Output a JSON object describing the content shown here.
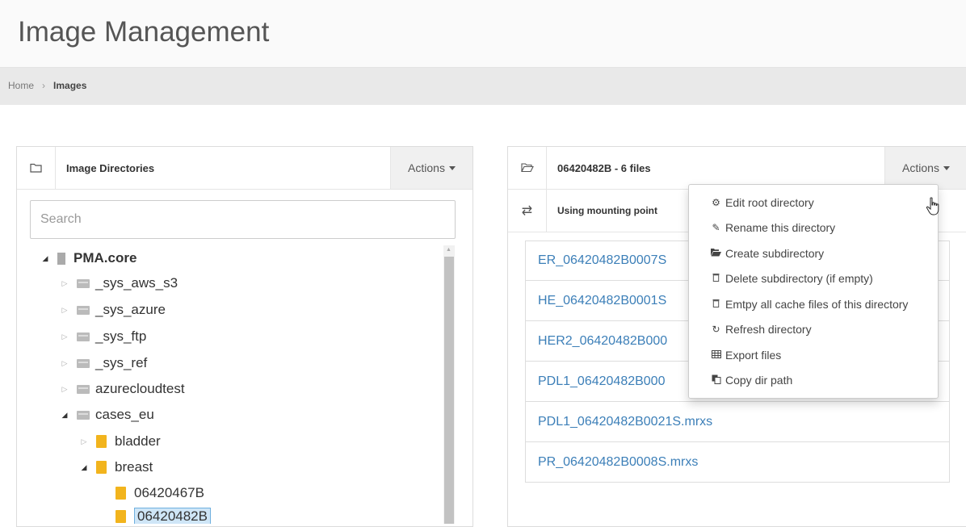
{
  "page": {
    "title": "Image Management"
  },
  "breadcrumb": {
    "home": "Home",
    "current": "Images"
  },
  "left_panel": {
    "title": "Image Directories",
    "actions_label": "Actions",
    "search_placeholder": "Search",
    "tree": {
      "root": "PMA.core",
      "items": [
        {
          "label": "_sys_aws_s3"
        },
        {
          "label": "_sys_azure"
        },
        {
          "label": "_sys_ftp"
        },
        {
          "label": "_sys_ref"
        },
        {
          "label": "azurecloudtest"
        },
        {
          "label": "cases_eu"
        },
        {
          "label": "bladder"
        },
        {
          "label": "breast"
        },
        {
          "label": "06420467B"
        },
        {
          "label": "06420482B"
        }
      ]
    }
  },
  "right_panel": {
    "title": "06420482B - 6 files",
    "actions_label": "Actions",
    "mount_text": "Using mounting point",
    "files": [
      "ER_06420482B0007S",
      "HE_06420482B0001S",
      "HER2_06420482B000",
      "PDL1_06420482B000",
      "PDL1_06420482B0021S.mrxs",
      "PR_06420482B0008S.mrxs"
    ]
  },
  "actions_menu": {
    "items": [
      {
        "label": "Edit root directory",
        "icon": "cogs-icon"
      },
      {
        "label": "Rename this directory",
        "icon": "pencil-icon"
      },
      {
        "label": "Create subdirectory",
        "icon": "folder-open-icon"
      },
      {
        "label": "Delete subdirectory (if empty)",
        "icon": "trash-icon"
      },
      {
        "label": "Emtpy all cache files of this directory",
        "icon": "trash-icon"
      },
      {
        "label": "Refresh directory",
        "icon": "refresh-icon"
      },
      {
        "label": "Export files",
        "icon": "table-icon"
      },
      {
        "label": "Copy dir path",
        "icon": "copy-icon"
      }
    ]
  },
  "colors": {
    "link": "#3c7fb8",
    "folder": "#f2b41d",
    "selection": "#cfe6f7"
  }
}
